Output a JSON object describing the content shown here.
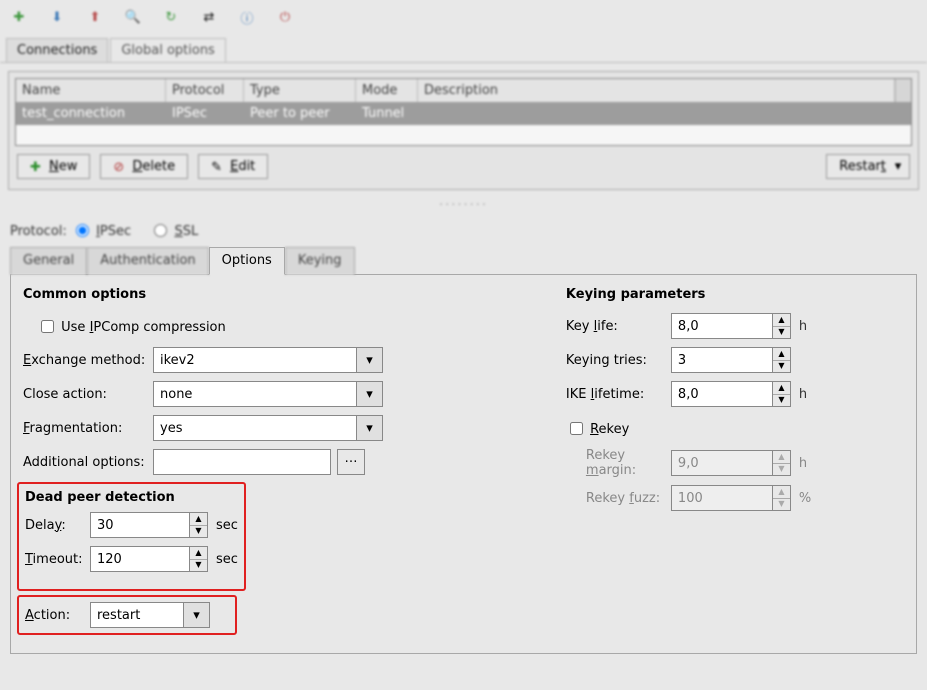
{
  "toolbar_icons": [
    "doc-new",
    "import",
    "export",
    "search",
    "refresh",
    "sync",
    "help",
    "quit"
  ],
  "top_tabs": {
    "connections": "Connections",
    "global": "Global options"
  },
  "table": {
    "headers": {
      "name": "Name",
      "protocol": "Protocol",
      "type": "Type",
      "mode": "Mode",
      "description": "Description"
    },
    "rows": [
      {
        "name": "test_connection",
        "protocol": "IPSec",
        "type": "Peer to peer",
        "mode": "Tunnel",
        "description": ""
      }
    ]
  },
  "buttons": {
    "new": "New",
    "delete": "Delete",
    "edit": "Edit",
    "restart": "Restart"
  },
  "protocol": {
    "label": "Protocol:",
    "ipsec": "IPSec",
    "ssl": "SSL"
  },
  "sub_tabs": {
    "general": "General",
    "auth": "Authentication",
    "options": "Options",
    "keying": "Keying"
  },
  "common": {
    "title": "Common options",
    "ipcomp": "Use IPComp compression",
    "exchange_label": "Exchange method:",
    "exchange_value": "ikev2",
    "close_label": "Close action:",
    "close_value": "none",
    "frag_label": "Fragmentation:",
    "frag_value": "yes",
    "addl_label": "Additional options:",
    "addl_value": "",
    "more": "…"
  },
  "dpd": {
    "title": "Dead peer detection",
    "delay_label": "Delay:",
    "delay_value": "30",
    "delay_unit": "sec",
    "timeout_label": "Timeout:",
    "timeout_value": "120",
    "timeout_unit": "sec",
    "action_label": "Action:",
    "action_value": "restart"
  },
  "keying": {
    "title": "Keying parameters",
    "keylife_label": "Key life:",
    "keylife_value": "8,0",
    "keylife_unit": "h",
    "tries_label": "Keying tries:",
    "tries_value": "3",
    "ikelife_label": "IKE lifetime:",
    "ikelife_value": "8,0",
    "ikelife_unit": "h",
    "rekey_label": "Rekey",
    "margin_label": "Rekey margin:",
    "margin_value": "9,0",
    "margin_unit": "h",
    "fuzz_label": "Rekey fuzz:",
    "fuzz_value": "100",
    "fuzz_unit": "%"
  }
}
